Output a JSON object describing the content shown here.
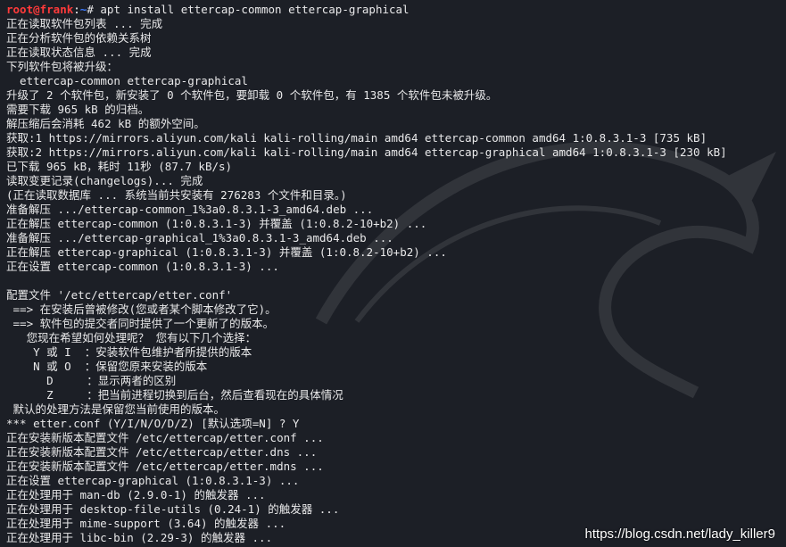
{
  "terminal": {
    "prompt": {
      "user_host": "root@frank",
      "separator": ":",
      "path": "~",
      "symbol": "# ",
      "command": "apt install ettercap-common ettercap-graphical"
    },
    "output": [
      "正在读取软件包列表 ... 完成",
      "正在分析软件包的依赖关系树",
      "正在读取状态信息 ... 完成",
      "下列软件包将被升级：",
      "  ettercap-common ettercap-graphical",
      "升级了 2 个软件包，新安装了 0 个软件包，要卸载 0 个软件包，有 1385 个软件包未被升级。",
      "需要下载 965 kB 的归档。",
      "解压缩后会消耗 462 kB 的额外空间。",
      "获取:1 https://mirrors.aliyun.com/kali kali-rolling/main amd64 ettercap-common amd64 1:0.8.3.1-3 [735 kB]",
      "获取:2 https://mirrors.aliyun.com/kali kali-rolling/main amd64 ettercap-graphical amd64 1:0.8.3.1-3 [230 kB]",
      "已下载 965 kB，耗时 11秒 (87.7 kB/s)",
      "读取变更记录(changelogs)... 完成",
      "(正在读取数据库 ... 系统当前共安装有 276283 个文件和目录。)",
      "准备解压 .../ettercap-common_1%3a0.8.3.1-3_amd64.deb ...",
      "正在解压 ettercap-common (1:0.8.3.1-3) 并覆盖 (1:0.8.2-10+b2) ...",
      "准备解压 .../ettercap-graphical_1%3a0.8.3.1-3_amd64.deb ...",
      "正在解压 ettercap-graphical (1:0.8.3.1-3) 并覆盖 (1:0.8.2-10+b2) ...",
      "正在设置 ettercap-common (1:0.8.3.1-3) ...",
      "",
      "配置文件 '/etc/ettercap/etter.conf'",
      " ==> 在安装后曾被修改(您或者某个脚本修改了它)。",
      " ==> 软件包的提交者同时提供了一个更新了的版本。",
      "   您现在希望如何处理呢？ 您有以下几个选择：",
      "    Y 或 I  ：安装软件包维护者所提供的版本",
      "    N 或 O  ：保留您原来安装的版本",
      "      D     ：显示两者的区别",
      "      Z     ：把当前进程切换到后台，然后查看现在的具体情况",
      " 默认的处理方法是保留您当前使用的版本。",
      "*** etter.conf (Y/I/N/O/D/Z) [默认选项=N] ? Y",
      "正在安装新版本配置文件 /etc/ettercap/etter.conf ...",
      "正在安装新版本配置文件 /etc/ettercap/etter.dns ...",
      "正在安装新版本配置文件 /etc/ettercap/etter.mdns ...",
      "正在设置 ettercap-graphical (1:0.8.3.1-3) ...",
      "正在处理用于 man-db (2.9.0-1) 的触发器 ...",
      "正在处理用于 desktop-file-utils (0.24-1) 的触发器 ...",
      "正在处理用于 mime-support (3.64) 的触发器 ...",
      "正在处理用于 libc-bin (2.29-3) 的触发器 ..."
    ]
  },
  "watermark": "https://blog.csdn.net/lady_killer9",
  "colors": {
    "background": "#1c1f26",
    "text": "#e9e9ea",
    "prompt_user": "#ff3a3a",
    "prompt_path": "#3d7bff"
  },
  "icons": {
    "background_logo": "kali-dragon-icon"
  }
}
